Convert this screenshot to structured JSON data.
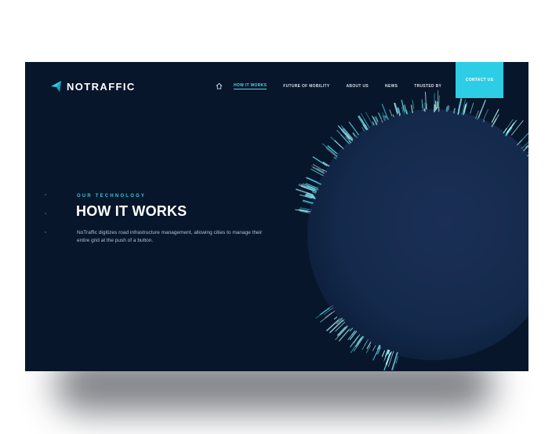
{
  "brand": {
    "name": "NOTRAFFIC"
  },
  "nav": {
    "home_icon": "home-icon",
    "items": [
      {
        "label": "HOW IT WORKS",
        "active": true
      },
      {
        "label": "FUTURE OF MOBILITY",
        "active": false
      },
      {
        "label": "ABOUT US",
        "active": false
      },
      {
        "label": "NEWS",
        "active": false
      },
      {
        "label": "TRUSTED BY",
        "active": false
      }
    ],
    "cta_label": "CONTACT US"
  },
  "hero": {
    "eyebrow": "OUR TECHNOLOGY",
    "title": "HOW IT WORKS",
    "description": "NoTraffic digitizes road infrastructure management, allowing cities to manage their entire grid at the push of a button."
  },
  "colors": {
    "background": "#07162b",
    "sphere": "#14284a",
    "accent": "#2ecde6",
    "particles": "#4fd6e6"
  }
}
